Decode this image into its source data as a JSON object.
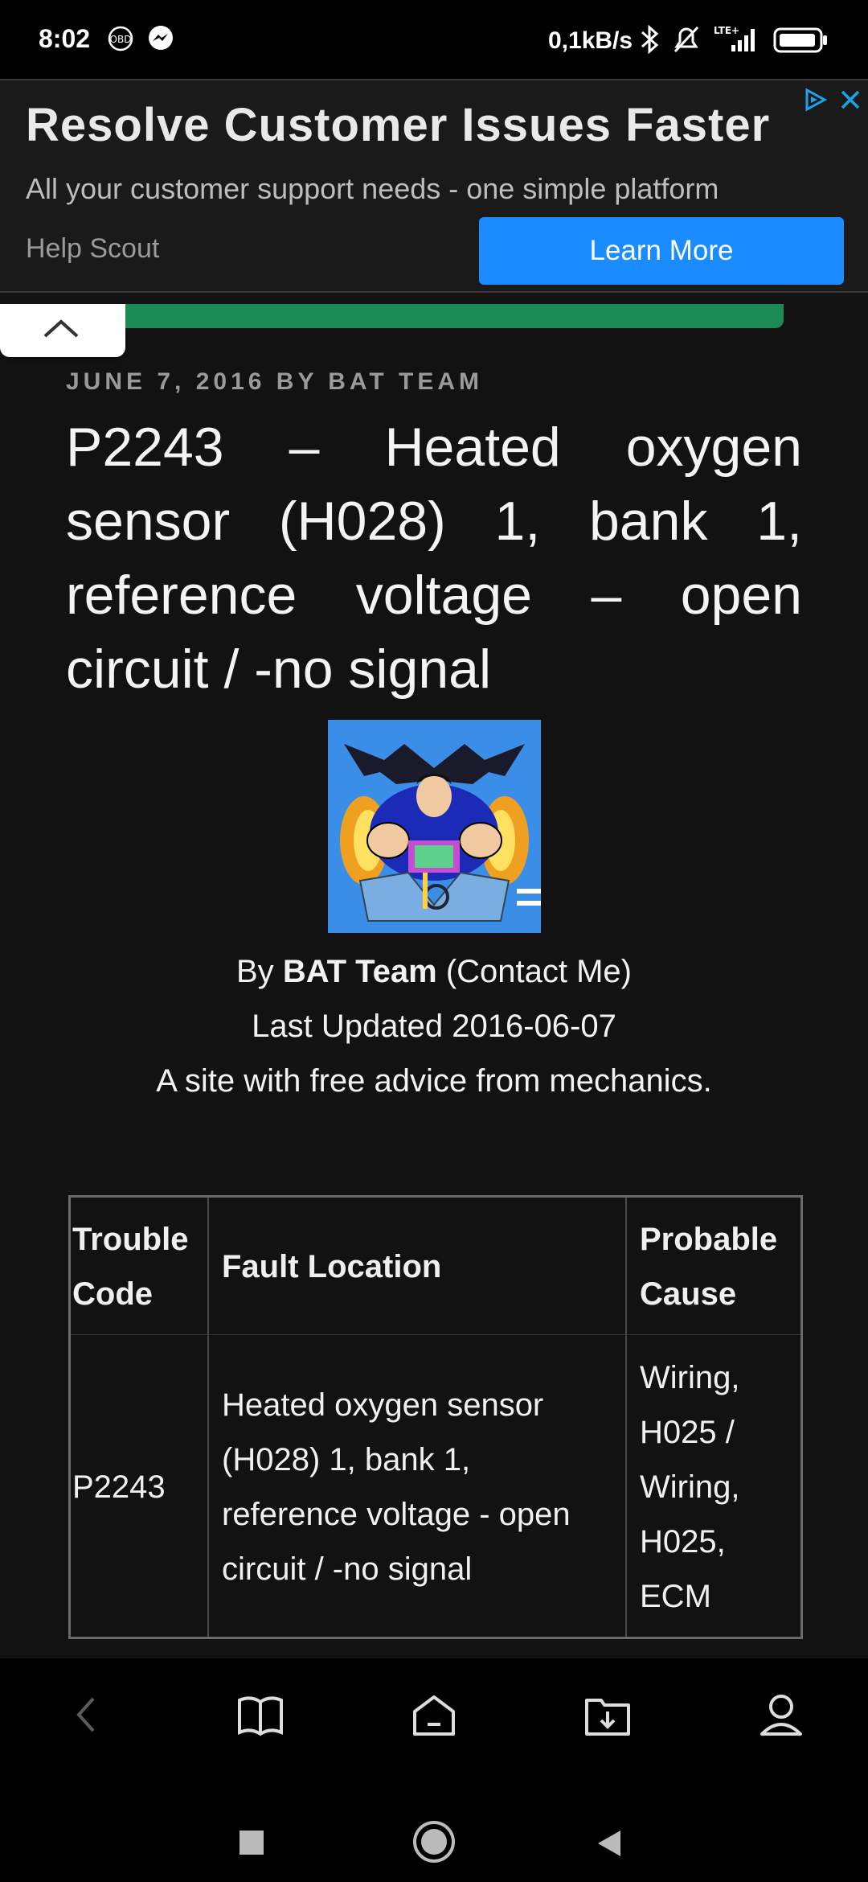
{
  "status_bar": {
    "time": "8:02",
    "net_rate": "0,1kB/s",
    "icons": [
      "obd-icon",
      "messenger-icon",
      "bluetooth-icon",
      "alarm-muted-icon",
      "lte-signal-icon",
      "battery-icon"
    ],
    "lte_label": "LTE+"
  },
  "ad": {
    "title": "Resolve Customer Issues Faster",
    "subtitle": "All your customer support needs - one simple platform",
    "brand": "Help Scout",
    "cta": "Learn More",
    "accent": "#1a8cff"
  },
  "progress": {
    "fraction": 0.98,
    "color": "#1b8a55"
  },
  "article": {
    "meta": "JUNE 7, 2016 BY BAT TEAM",
    "title": "P2243 – Heated oxygen sensor (H028) 1, bank 1, reference voltage – open circuit / -no signal",
    "author_prefix": "By",
    "author_name": "BAT Team",
    "author_contact": "(Contact Me)",
    "updated": "Last Updated 2016-06-07",
    "tagline": "A site with free advice from mechanics."
  },
  "table": {
    "headers": [
      "Trouble Code",
      "Fault Location",
      "Probable Cause"
    ],
    "rows": [
      {
        "code": "P2243",
        "location": "Heated oxygen sensor (H028) 1, bank 1, reference voltage - open circuit / -no signal",
        "cause": "Wiring, H025 / Wiring, H025, ECM"
      }
    ]
  },
  "browser_nav": [
    "back-icon",
    "bookmarks-icon",
    "home-icon",
    "downloads-icon",
    "profile-icon"
  ],
  "system_nav": [
    "recents-icon",
    "home-icon",
    "back-icon"
  ]
}
